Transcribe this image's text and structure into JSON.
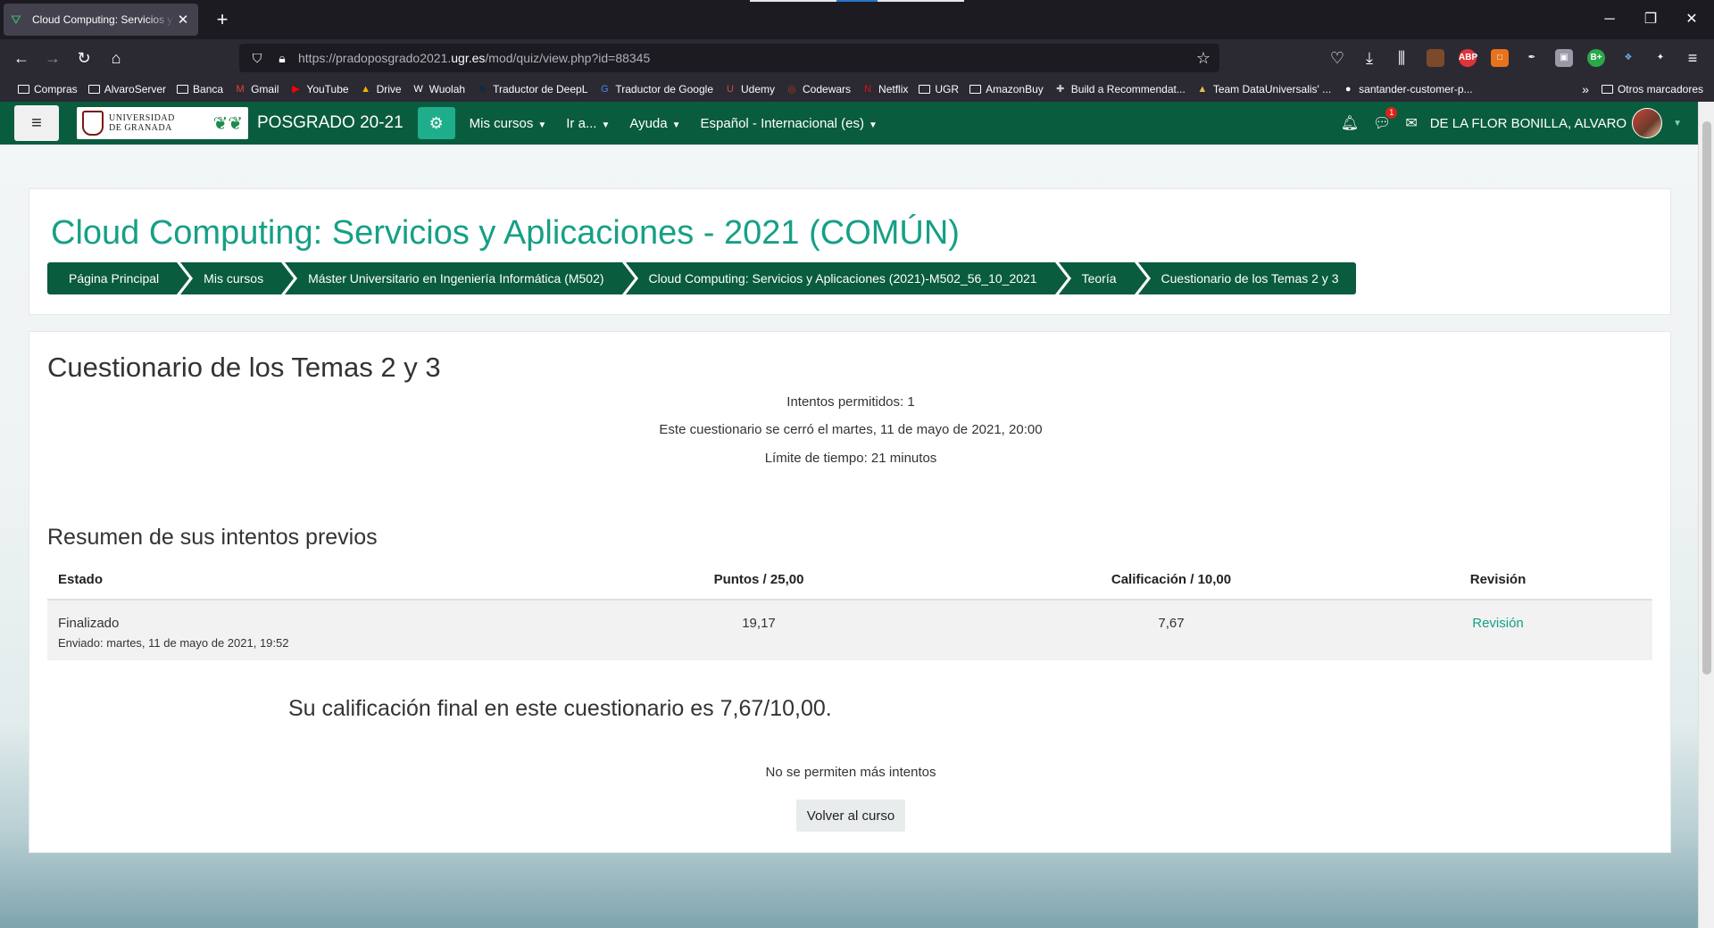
{
  "browser": {
    "tab_title": "Cloud Computing: Servicios y Aplicaciones",
    "url_prefix": "https://pradoposgrado2021.",
    "url_domain": "ugr.es",
    "url_path": "/mod/quiz/view.php?id=88345",
    "bookmarks": [
      {
        "label": "Compras",
        "icon": "folder-icon"
      },
      {
        "label": "AlvaroServer",
        "icon": "folder-icon"
      },
      {
        "label": "Banca",
        "icon": "folder-icon"
      },
      {
        "label": "Gmail",
        "icon": "gmail-icon"
      },
      {
        "label": "YouTube",
        "icon": "youtube-icon"
      },
      {
        "label": "Drive",
        "icon": "drive-icon"
      },
      {
        "label": "Wuolah",
        "icon": "wuolah-icon"
      },
      {
        "label": "Traductor de DeepL",
        "icon": "deepl-icon"
      },
      {
        "label": "Traductor de Google",
        "icon": "google-translate-icon"
      },
      {
        "label": "Udemy",
        "icon": "udemy-icon"
      },
      {
        "label": "Codewars",
        "icon": "codewars-icon"
      },
      {
        "label": "Netflix",
        "icon": "netflix-icon"
      },
      {
        "label": "UGR",
        "icon": "folder-icon"
      },
      {
        "label": "AmazonBuy",
        "icon": "folder-icon"
      },
      {
        "label": "Build a Recommendat...",
        "icon": "kaggle-icon"
      },
      {
        "label": "Team DataUniversalis' ...",
        "icon": "team-icon"
      },
      {
        "label": "santander-customer-p...",
        "icon": "github-icon"
      }
    ],
    "other_bookmarks": "Otros marcadores"
  },
  "moodle_nav": {
    "university_line1": "UNIVERSIDAD",
    "university_line2": "DE GRANADA",
    "site_name": "POSGRADO 20-21",
    "menus": [
      "Mis cursos",
      "Ir a...",
      "Ayuda",
      "Español - Internacional (es)"
    ],
    "messages_badge": "1",
    "user_name": "DE LA FLOR BONILLA, ALVARO"
  },
  "header": {
    "course_title": "Cloud Computing: Servicios y Aplicaciones - 2021 (COMÚN)",
    "breadcrumb": [
      "Página Principal",
      "Mis cursos",
      "Máster Universitario en Ingeniería Informática (M502)",
      "Cloud Computing: Servicios y Aplicaciones (2021)-M502_56_10_2021",
      "Teoría",
      "Cuestionario de los Temas 2 y 3"
    ]
  },
  "quiz": {
    "title": "Cuestionario de los Temas 2 y 3",
    "attempts_allowed": "Intentos permitidos: 1",
    "closed_info": "Este cuestionario se cerró el martes, 11 de mayo de 2021, 20:00",
    "time_limit": "Límite de tiempo: 21 minutos",
    "summary_title": "Resumen de sus intentos previos",
    "table": {
      "headers": [
        "Estado",
        "Puntos / 25,00",
        "Calificación / 10,00",
        "Revisión"
      ],
      "rows": [
        {
          "state": "Finalizado",
          "submitted": "Enviado: martes, 11 de mayo de 2021, 19:52",
          "points": "19,17",
          "grade": "7,67",
          "review": "Revisión"
        }
      ]
    },
    "final_grade": "Su calificación final en este cuestionario es 7,67/10,00.",
    "no_more_attempts": "No se permiten más intentos",
    "back_button": "Volver al curso"
  },
  "colors": {
    "brand_green": "#0a5c3e",
    "accent_teal": "#16a085",
    "gear_button": "#1fae8c"
  }
}
